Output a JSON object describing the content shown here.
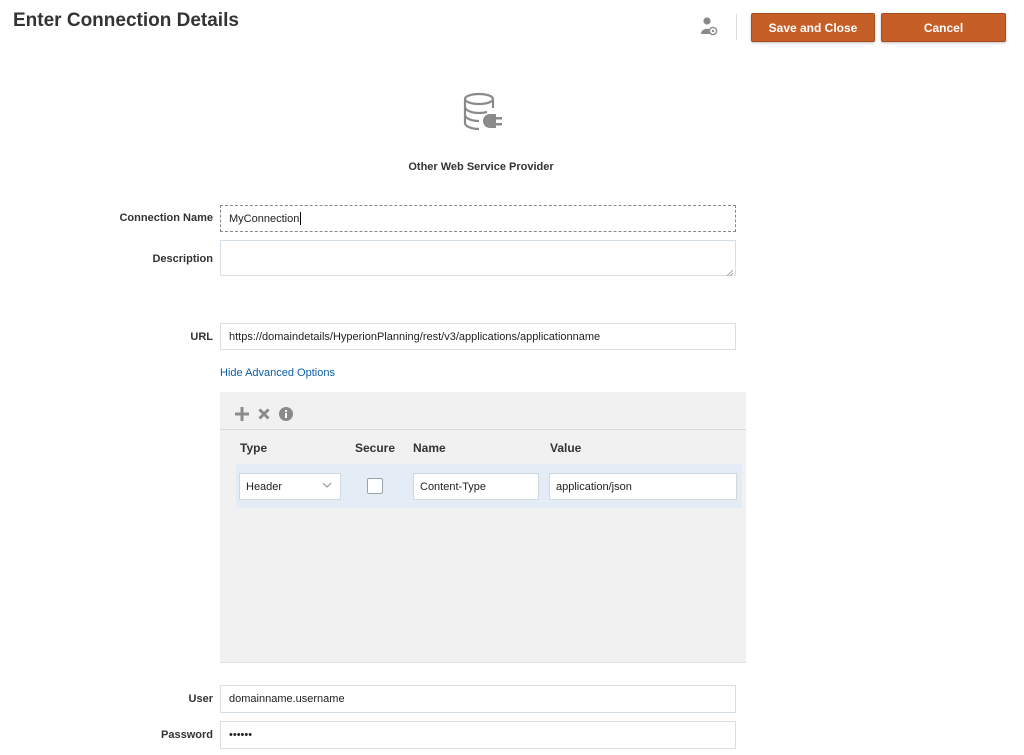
{
  "header": {
    "title": "Enter Connection Details",
    "save_label": "Save and Close",
    "cancel_label": "Cancel",
    "user_icon": "user-settings-icon"
  },
  "provider": {
    "icon": "database-connection-icon",
    "name": "Other Web Service Provider"
  },
  "form": {
    "connection_name": {
      "label": "Connection Name",
      "value": "MyConnection"
    },
    "description": {
      "label": "Description",
      "value": ""
    },
    "url": {
      "label": "URL",
      "value": "https://domaindetails/HyperionPlanning/rest/v3/applications/applicationname"
    },
    "user": {
      "label": "User",
      "value": "domainname.username"
    },
    "password": {
      "label": "Password",
      "value": "••••••"
    }
  },
  "advanced": {
    "toggle_label": "Hide Advanced Options",
    "toolbar_icons": [
      "add-icon",
      "delete-icon",
      "info-icon"
    ],
    "columns": {
      "type": "Type",
      "secure": "Secure",
      "name": "Name",
      "value": "Value"
    },
    "rows": [
      {
        "type": "Header",
        "secure": false,
        "name": "Content-Type",
        "value": "application/json"
      }
    ]
  },
  "colors": {
    "accent_button": "#c55f27",
    "link": "#0b5ea6",
    "row_highlight": "#e4edf6"
  }
}
